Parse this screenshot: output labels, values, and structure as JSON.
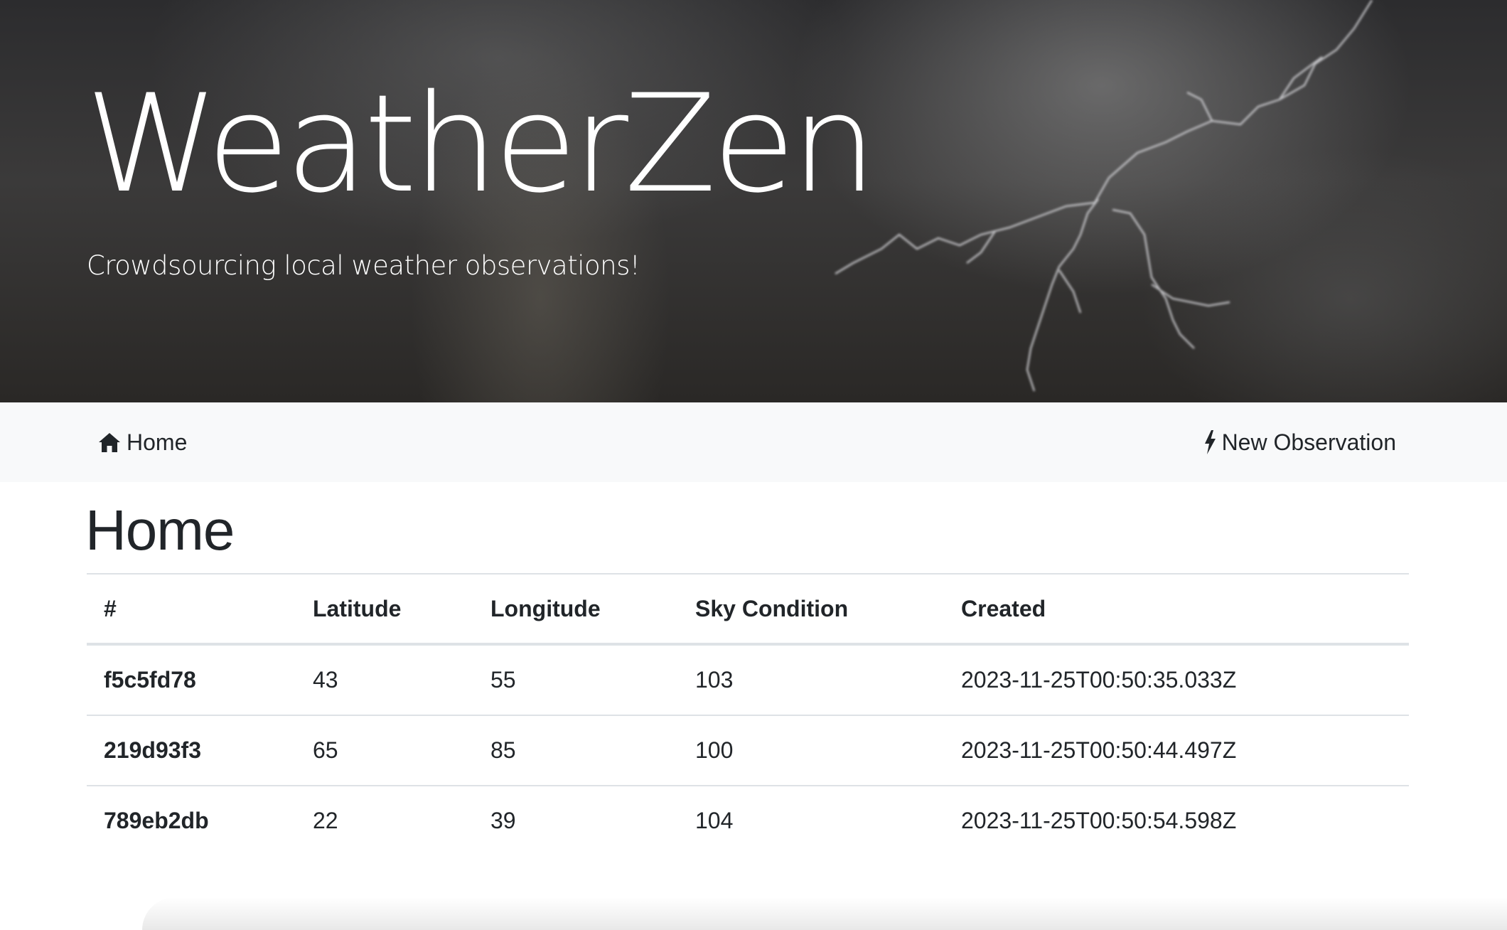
{
  "hero": {
    "title": "WeatherZen",
    "subtitle": "Crowdsourcing local weather observations!"
  },
  "navbar": {
    "home": {
      "label": "Home",
      "icon": "home-icon"
    },
    "new_observation": {
      "label": "New Observation",
      "icon": "lightning-icon"
    }
  },
  "main": {
    "title": "Home",
    "table": {
      "headers": [
        "#",
        "Latitude",
        "Longitude",
        "Sky Condition",
        "Created"
      ],
      "rows": [
        {
          "id": "f5c5fd78",
          "latitude": "43",
          "longitude": "55",
          "sky_condition": "103",
          "created": "2023-11-25T00:50:35.033Z"
        },
        {
          "id": "219d93f3",
          "latitude": "65",
          "longitude": "85",
          "sky_condition": "100",
          "created": "2023-11-25T00:50:44.497Z"
        },
        {
          "id": "789eb2db",
          "latitude": "22",
          "longitude": "39",
          "sky_condition": "104",
          "created": "2023-11-25T00:50:54.598Z"
        }
      ]
    }
  },
  "colors": {
    "navbar_bg": "#f8f9fa",
    "text": "#212529",
    "border": "#dee2e6",
    "hero_text": "#ffffff"
  }
}
